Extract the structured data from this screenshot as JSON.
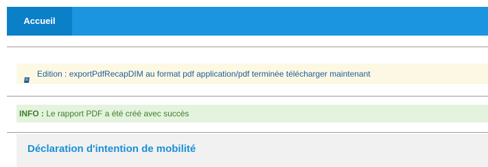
{
  "nav": {
    "home_tab": "Accueil"
  },
  "download_alert": {
    "text": "Edition : exportPdfRecapDIM au format pdf application/pdf terminée télécharger maintenant",
    "icon": "document-icon"
  },
  "info_alert": {
    "label": "INFO :",
    "message": " Le rapport PDF a été créé avec succès"
  },
  "section": {
    "title": "Déclaration d'intention de mobilité"
  },
  "colors": {
    "topbar": "#1b95e0",
    "active_tab": "#0c7fc9",
    "download_bg": "#fdf8e3",
    "download_text": "#1c5d99",
    "info_bg": "#e4f3dd",
    "info_text": "#3d7d2b",
    "section_bg": "#f1f1f1",
    "section_title": "#1b8fd6"
  }
}
